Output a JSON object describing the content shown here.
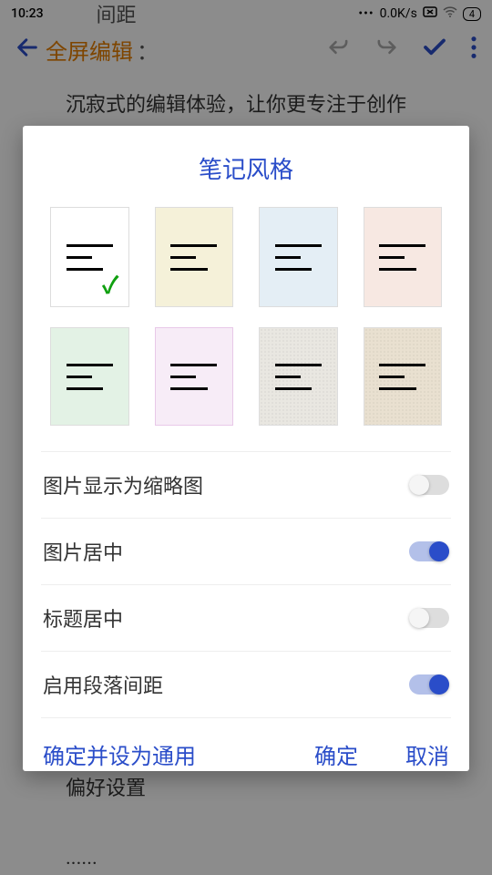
{
  "status": {
    "time": "10:23",
    "center_text": "间距",
    "dots": "•••",
    "speed": "0.0K/s",
    "battery": "4"
  },
  "toolbar": {
    "title": "全屏编辑",
    "colon": "："
  },
  "body": {
    "line1": "沉寂式的编辑体验，让你更专注于创作",
    "line2": "支持多种编辑背景选择，以及一些常用的偏好设置",
    "dots": "......"
  },
  "dialog": {
    "title": "笔记风格",
    "settings": [
      {
        "label": "图片显示为缩略图",
        "on": false
      },
      {
        "label": "图片居中",
        "on": true
      },
      {
        "label": "标题居中",
        "on": false
      },
      {
        "label": "启用段落间距",
        "on": true
      }
    ],
    "actions": {
      "set_default": "确定并设为通用",
      "ok": "确定",
      "cancel": "取消"
    }
  }
}
